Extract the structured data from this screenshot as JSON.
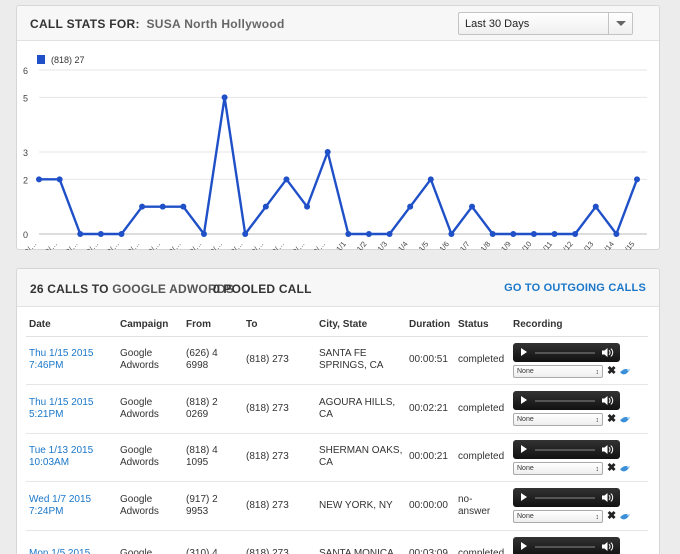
{
  "stats": {
    "title": "CALL STATS FOR:",
    "location": "SUSA North Hollywood",
    "range": "Last 30 Days"
  },
  "chart_data": {
    "type": "line",
    "categories": [
      "12/…",
      "12/…",
      "12/…",
      "12/…",
      "12/…",
      "12/…",
      "12/…",
      "12/…",
      "12/…",
      "12/…",
      "12/…",
      "12/…",
      "12/…",
      "12/…",
      "12/…",
      "1/1",
      "1/2",
      "1/3",
      "1/4",
      "1/5",
      "1/6",
      "1/7",
      "1/8",
      "1/9",
      "1/10",
      "1/11",
      "1/12",
      "1/13",
      "1/14",
      "1/15"
    ],
    "series": [
      {
        "name": "(818) 27",
        "color": "#1f50c8",
        "values": [
          2,
          2,
          0,
          0,
          0,
          1,
          1,
          1,
          0,
          5,
          0,
          1,
          2,
          1,
          3,
          0,
          0,
          0,
          1,
          2,
          0,
          1,
          0,
          0,
          0,
          0,
          0,
          1,
          0,
          2
        ]
      }
    ],
    "yticks": [
      0,
      2,
      3,
      5,
      6
    ],
    "ylim": [
      0,
      6
    ],
    "grid": true,
    "legend": "top-left"
  },
  "calls": {
    "count_label": "26 CALLS TO",
    "source": "GOOGLE ADWORDS",
    "pooled": "0 POOLED CALL",
    "outgoing": "GO TO OUTGOING CALLS",
    "columns": [
      "Date",
      "Campaign",
      "From",
      "To",
      "City, State",
      "Duration",
      "Status",
      "Recording"
    ],
    "rows": [
      {
        "date1": "Thu 1/15 2015",
        "date2": "7:46PM",
        "camp1": "Google",
        "camp2": "Adwords",
        "from1": "(626) 4",
        "from2": "6998",
        "to": "(818) 273",
        "city1": "SANTA FE",
        "city2": "SPRINGS, CA",
        "duration": "00:00:51",
        "status1": "completed",
        "status2": "",
        "tag": "None"
      },
      {
        "date1": "Thu 1/15 2015",
        "date2": "5:21PM",
        "camp1": "Google",
        "camp2": "Adwords",
        "from1": "(818) 2",
        "from2": "0269",
        "to": "(818) 273",
        "city1": "AGOURA HILLS,",
        "city2": "CA",
        "duration": "00:02:21",
        "status1": "completed",
        "status2": "",
        "tag": "None"
      },
      {
        "date1": "Tue 1/13 2015",
        "date2": "10:03AM",
        "camp1": "Google",
        "camp2": "Adwords",
        "from1": "(818) 4",
        "from2": "1095",
        "to": "(818) 273",
        "city1": "SHERMAN OAKS,",
        "city2": "CA",
        "duration": "00:00:21",
        "status1": "completed",
        "status2": "",
        "tag": "None"
      },
      {
        "date1": "Wed 1/7 2015",
        "date2": "7:24PM",
        "camp1": "Google",
        "camp2": "Adwords",
        "from1": "(917) 2",
        "from2": "9953",
        "to": "(818) 273",
        "city1": "NEW YORK, NY",
        "city2": "",
        "duration": "00:00:00",
        "status1": "no-",
        "status2": "answer",
        "tag": "None"
      },
      {
        "date1": "Mon 1/5 2015",
        "date2": "",
        "camp1": "Google",
        "camp2": "",
        "from1": "(310) 4",
        "from2": "",
        "to": "(818) 273",
        "city1": "SANTA MONICA,",
        "city2": "",
        "duration": "00:03:09",
        "status1": "completed",
        "status2": "",
        "tag": "None"
      }
    ]
  }
}
